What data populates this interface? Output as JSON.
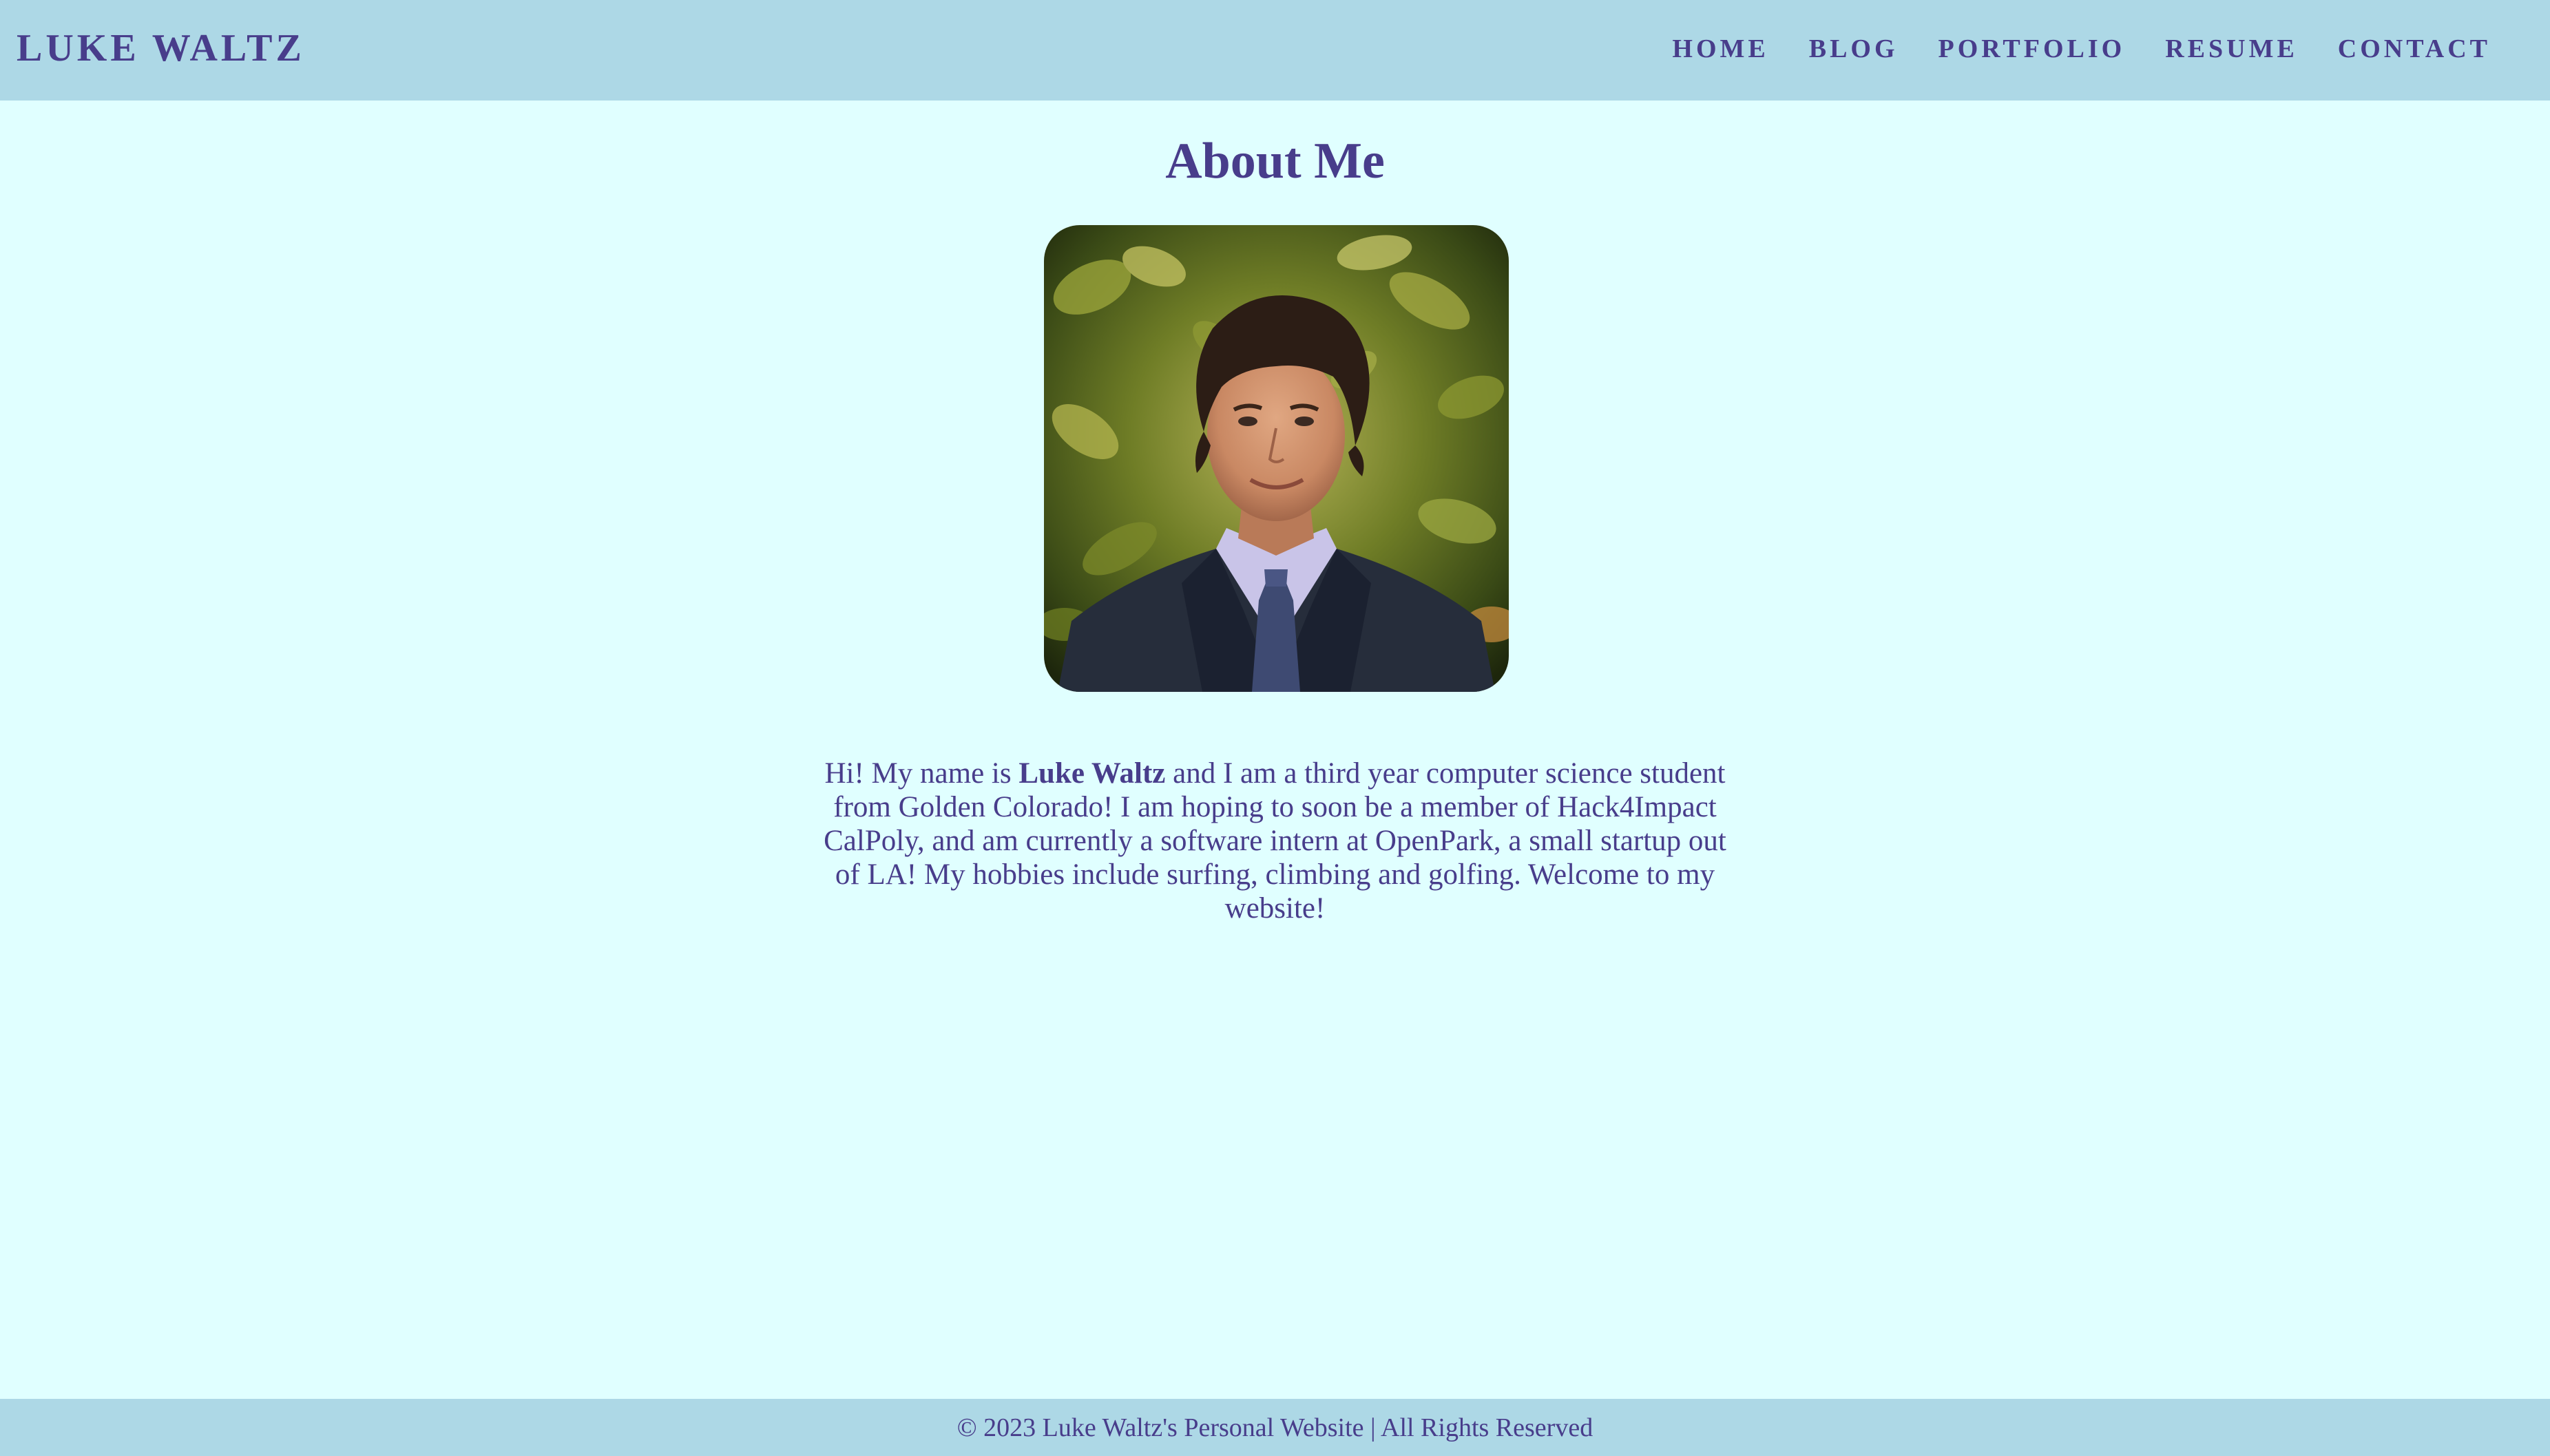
{
  "header": {
    "logo": "LUKE WALTZ",
    "nav": [
      "HOME",
      "BLOG",
      "PORTFOLIO",
      "RESUME",
      "CONTACT"
    ]
  },
  "main": {
    "title": "About Me",
    "photo_alt": "Luke Waltz",
    "bio": {
      "intro": "Hi! My name is",
      "name": "Luke Waltz",
      "rest": "and I am a third year computer science student from Golden Colorado! I am hoping to soon be a member of Hack4Impact CalPoly, and am currently a software intern at OpenPark, a small startup out of LA! My hobbies include surfing, climbing and golfing. Welcome to my website!"
    }
  },
  "footer": {
    "text": "© 2023 Luke Waltz's Personal Website | All Rights Reserved"
  },
  "colors": {
    "page_bg": "#e0ffff",
    "bar_bg": "#add8e6",
    "text": "#483d8b"
  }
}
